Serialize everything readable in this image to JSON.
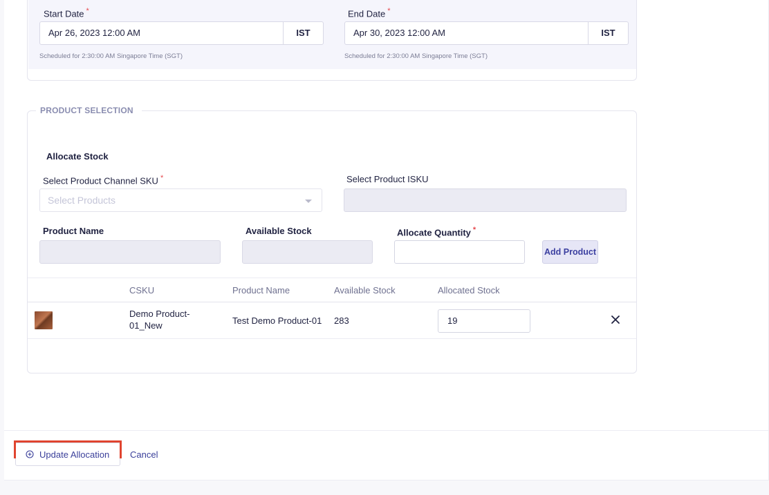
{
  "schedule": {
    "start_label": "Start Date",
    "start_value": "Apr 26, 2023 12:00 AM",
    "start_tz": "IST",
    "start_hint": "Scheduled for 2:30:00 AM Singapore Time (SGT)",
    "end_label": "End Date",
    "end_value": "Apr 30, 2023 12:00 AM",
    "end_tz": "IST",
    "end_hint": "Scheduled for 2:30:00 AM Singapore Time (SGT)",
    "required_mark": "*"
  },
  "product_selection": {
    "legend": "PRODUCT SELECTION",
    "allocate_heading": "Allocate Stock",
    "channel_sku_label": "Select Product Channel SKU",
    "channel_sku_placeholder": "Select Products",
    "isku_label": "Select Product ISKU",
    "product_name_label": "Product Name",
    "available_stock_label": "Available Stock",
    "allocate_qty_label": "Allocate Quantity",
    "add_button": "Add Product",
    "required_mark": "*"
  },
  "table": {
    "headers": [
      "CSKU",
      "Product Name",
      "Available Stock",
      "Allocated Stock"
    ],
    "rows": [
      {
        "csku_line1": "Demo Product-",
        "csku_line2": "01_New",
        "product_name": "Test Demo Product-01",
        "available_stock": "283",
        "allocated_stock": "19"
      }
    ]
  },
  "footer": {
    "update_button": "Update Allocation",
    "cancel_link": "Cancel"
  },
  "colors": {
    "accent": "#3a3f9a",
    "highlight": "#e0442f",
    "required": "#e5484d"
  }
}
